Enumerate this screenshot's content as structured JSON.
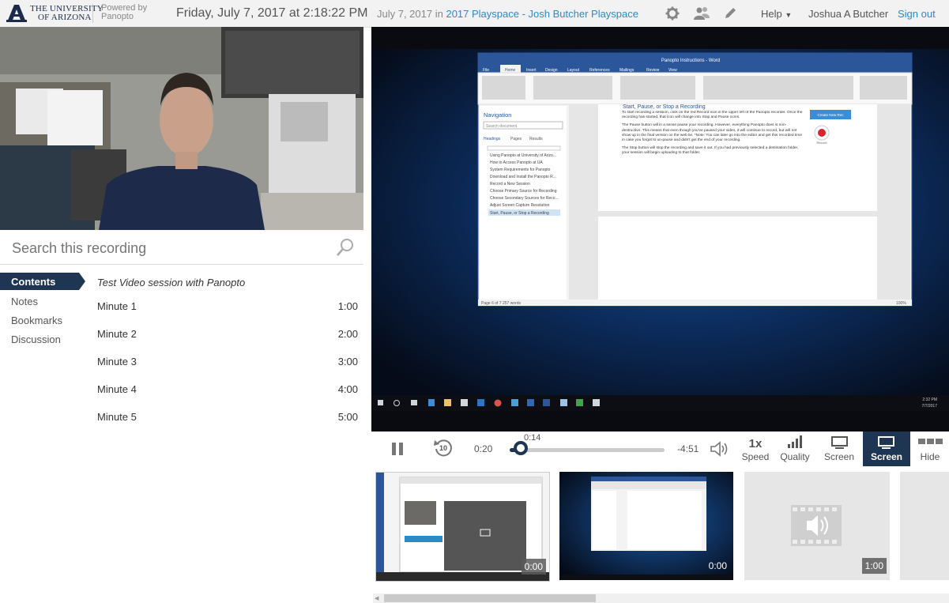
{
  "header": {
    "university_line1": "THE UNIVERSITY",
    "university_line2": "OF ARIZONA",
    "powered_line1": "Powered by",
    "powered_line2": "Panopto",
    "datetime": "Friday, July 7, 2017 at 2:18:22 PM",
    "crumb_date": "July 7, 2017 in",
    "crumb_folder": "2017 Playspace - Josh Butcher Playspace",
    "help_label": "Help",
    "user_name": "Joshua A Butcher",
    "signout_label": "Sign out"
  },
  "search": {
    "placeholder": "Search this recording"
  },
  "nav": {
    "items": [
      {
        "label": "Contents",
        "active": true
      },
      {
        "label": "Notes",
        "active": false
      },
      {
        "label": "Bookmarks",
        "active": false
      },
      {
        "label": "Discussion",
        "active": false
      }
    ]
  },
  "contents": {
    "title": "Test Video session with Panopto",
    "entries": [
      {
        "label": "Minute 1",
        "time": "1:00"
      },
      {
        "label": "Minute 2",
        "time": "2:00"
      },
      {
        "label": "Minute 3",
        "time": "3:00"
      },
      {
        "label": "Minute 4",
        "time": "4:00"
      },
      {
        "label": "Minute 5",
        "time": "5:00"
      }
    ]
  },
  "player": {
    "word_doc": {
      "title_bar": "Panopto Instructions - Word",
      "ribbon_tabs": [
        "File",
        "Home",
        "Insert",
        "Design",
        "Layout",
        "References",
        "Mailings",
        "Review",
        "View"
      ],
      "nav_title": "Navigation",
      "nav_search": "Search document",
      "nav_tabs": [
        "Headings",
        "Pages",
        "Results"
      ],
      "nav_headings": [
        "Using Panopto at University of Arizo...",
        "How to Access Panopto at UA",
        "System Requirements for Panopto",
        "Download and Install the Panopto R...",
        "Record a New Session",
        "Choose Primary Source for Recording",
        "Choose Secondary Sources for Reco...",
        "Adjust Screen Capture Resolution",
        "Start, Pause, or Stop a Recording"
      ],
      "heading": "Start, Pause, or Stop a Recording",
      "para1": "To start recording a session, click on the red Record icon in the upper left of the Panopto recorder. Once the recording has started, that icon will change into Stop and Pause icons.",
      "para2": "The Pause button will in a sense pause your recording. However, everything Panopto does is non-destructive. This means that even though you've paused your video, it will continue to record, but will not show up in the final version on the web tie. *Note: You can later go into the editor and get this recorded time in case you forgot to un-pause and didn't get the end of your recording.",
      "para3": "The Stop button will stop the recording and save it out. If you had previously selected a destination folder, your session will begin uploading to that folder.",
      "status": "Page 6 of 7     257 words",
      "zoom": "100%",
      "recorder_btn": "Create New Rec",
      "record_label": "Record"
    },
    "taskbar_time": "2:32 PM",
    "taskbar_date": "7/7/2017"
  },
  "controls": {
    "elapsed": "0:20",
    "remaining": "-4:51",
    "scrub_tooltip": "0:14",
    "skip_back_label": "10",
    "progress_fraction": 0.07,
    "speed_value": "1x",
    "speed_label": "Speed",
    "quality_label": "Quality",
    "screen1_label": "Screen",
    "screen2_label": "Screen",
    "hide_label": "Hide"
  },
  "thumbnails": [
    {
      "time": "0:00"
    },
    {
      "time": "0:00"
    },
    {
      "time": "1:00"
    },
    {
      "time": ""
    }
  ],
  "colors": {
    "accent_blue": "#2a8bc9",
    "nav_active": "#1f3554",
    "header_bg": "#f2f2f2",
    "player_bg": "#0a0e16"
  }
}
